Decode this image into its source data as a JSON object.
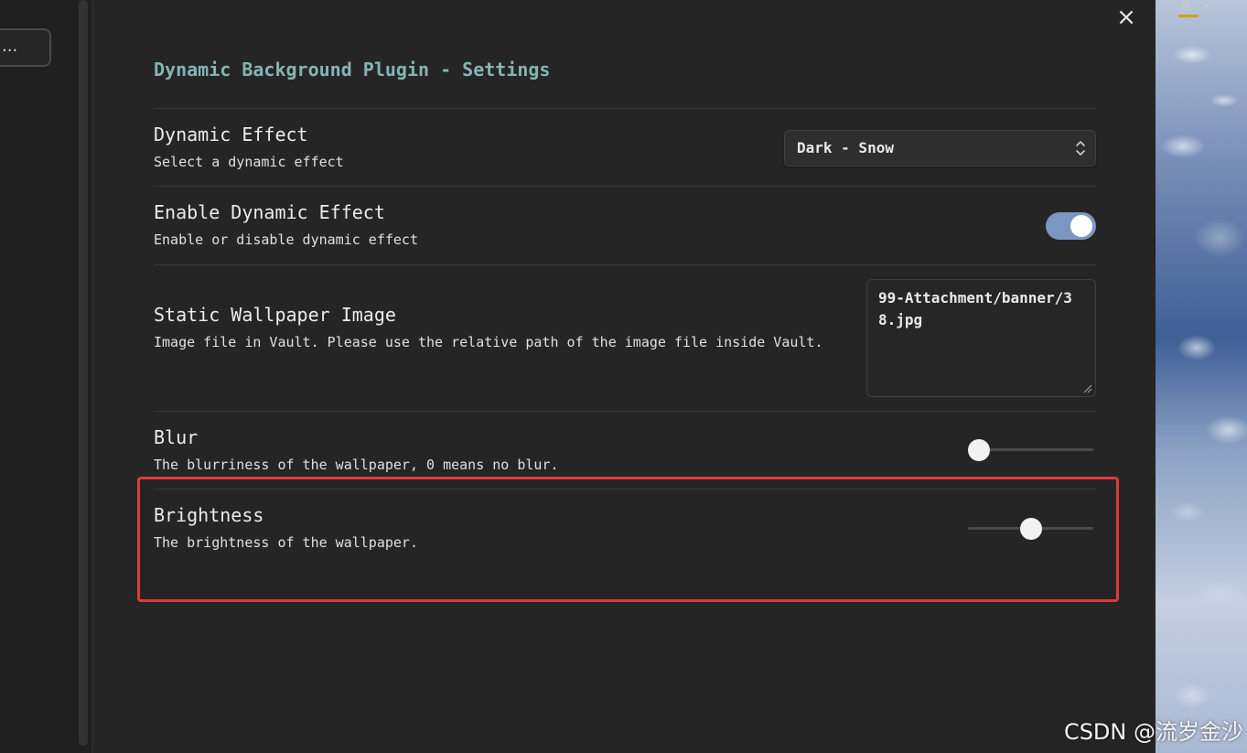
{
  "sidebar": {
    "button_label": "..."
  },
  "topbar": {
    "letter": "A",
    "caret": "▾",
    "underline_color": "#d4a017"
  },
  "modal": {
    "close_icon": "×",
    "title": "Dynamic Background Plugin - Settings",
    "settings": [
      {
        "name": "Dynamic Effect",
        "description": "Select a dynamic effect",
        "control": "dropdown",
        "value": "Dark - Snow"
      },
      {
        "name": "Enable Dynamic Effect",
        "description": "Enable or disable dynamic effect",
        "control": "toggle",
        "value": true
      },
      {
        "name": "Static Wallpaper Image",
        "description": "Image file in Vault. Please use the relative path of the image file inside Vault.",
        "control": "textarea",
        "value": "99-Attachment/banner/38.jpg"
      },
      {
        "name": "Blur",
        "description": "The blurriness of the wallpaper, 0 means no blur.",
        "control": "slider",
        "value_fraction": 0.09
      },
      {
        "name": "Brightness",
        "description": "The brightness of the wallpaper.",
        "control": "slider",
        "value_fraction": 0.5
      }
    ]
  },
  "colors": {
    "title": "#86b4b4",
    "toggle_on": "#7b96c0",
    "highlight": "#e03a3a"
  },
  "watermark": "CSDN @流岁金沙"
}
